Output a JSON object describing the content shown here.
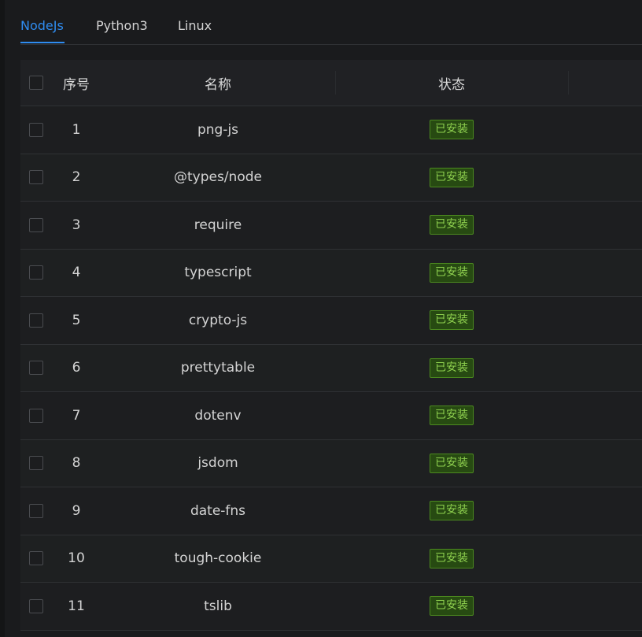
{
  "tabs": [
    {
      "label": "NodeJs",
      "active": true
    },
    {
      "label": "Python3",
      "active": false
    },
    {
      "label": "Linux",
      "active": false
    }
  ],
  "table": {
    "headers": {
      "index": "序号",
      "name": "名称",
      "status": "状态"
    },
    "rows": [
      {
        "index": "1",
        "name": "png-js",
        "status": "已安装"
      },
      {
        "index": "2",
        "name": "@types/node",
        "status": "已安装"
      },
      {
        "index": "3",
        "name": "require",
        "status": "已安装"
      },
      {
        "index": "4",
        "name": "typescript",
        "status": "已安装"
      },
      {
        "index": "5",
        "name": "crypto-js",
        "status": "已安装"
      },
      {
        "index": "6",
        "name": "prettytable",
        "status": "已安装"
      },
      {
        "index": "7",
        "name": "dotenv",
        "status": "已安装"
      },
      {
        "index": "8",
        "name": "jsdom",
        "status": "已安装"
      },
      {
        "index": "9",
        "name": "date-fns",
        "status": "已安装"
      },
      {
        "index": "10",
        "name": "tough-cookie",
        "status": "已安装"
      },
      {
        "index": "11",
        "name": "tslib",
        "status": "已安装"
      }
    ]
  },
  "colors": {
    "accent": "#2f8cf0",
    "status_installed_text": "#8fd14f",
    "status_installed_bg": "#274a12",
    "status_installed_border": "#4c8a1f",
    "background": "#1a1b1d"
  }
}
